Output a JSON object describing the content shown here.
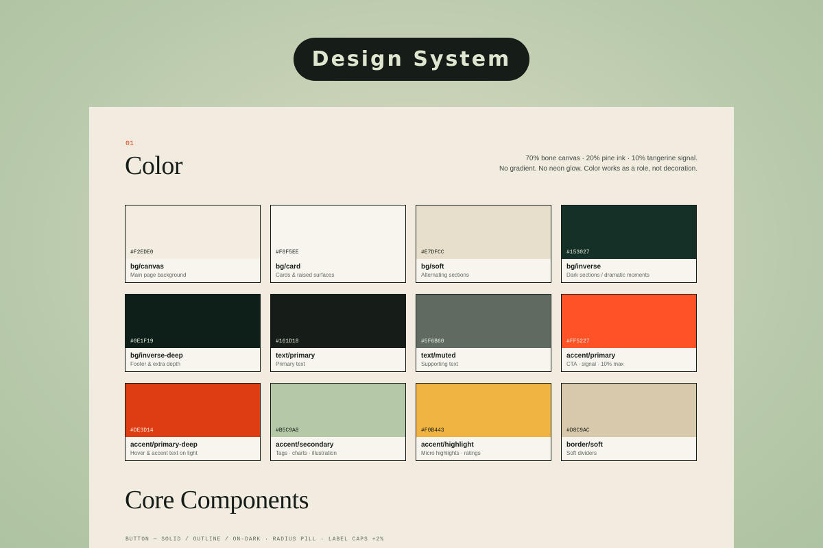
{
  "header": {
    "title": "Design System"
  },
  "color_section": {
    "number": "01",
    "title": "Color",
    "description_line1": "70% bone canvas · 20% pine ink · 10% tangerine signal.",
    "description_line2": "No gradient. No neon glow. Color works as a role, not decoration."
  },
  "swatches": [
    {
      "hex": "#F2EDE0",
      "name": "bg/canvas",
      "note": "Main page background",
      "color": "#F2EDE0",
      "text_color": "#161D18"
    },
    {
      "hex": "#F8F5EE",
      "name": "bg/card",
      "note": "Cards & raised surfaces",
      "color": "#F8F5EE",
      "text_color": "#161D18"
    },
    {
      "hex": "#E7DFCC",
      "name": "bg/soft",
      "note": "Alternating sections",
      "color": "#E7DFCC",
      "text_color": "#161D18"
    },
    {
      "hex": "#153027",
      "name": "bg/inverse",
      "note": "Dark sections / dramatic moments",
      "color": "#153027",
      "text_color": "#E8EDE0"
    },
    {
      "hex": "#0E1F19",
      "name": "bg/inverse-deep",
      "note": "Footer & extra depth",
      "color": "#0E1F19",
      "text_color": "#E8EDE0"
    },
    {
      "hex": "#161D18",
      "name": "text/primary",
      "note": "Primary text",
      "color": "#161D18",
      "text_color": "#E8EDE0"
    },
    {
      "hex": "#5F6B60",
      "name": "text/muted",
      "note": "Supporting text",
      "color": "#5F6B60",
      "text_color": "#E8EDE0"
    },
    {
      "hex": "#FF5227",
      "name": "accent/primary",
      "note": "CTA · signal · 10% max",
      "color": "#FF5227",
      "text_color": "#FBE9E0"
    },
    {
      "hex": "#DE3D14",
      "name": "accent/primary-deep",
      "note": "Hover & accent text on light",
      "color": "#DE3D14",
      "text_color": "#FBE9E0"
    },
    {
      "hex": "#B5C9A8",
      "name": "accent/secondary",
      "note": "Tags · charts · illustration",
      "color": "#B5C9A8",
      "text_color": "#161D18"
    },
    {
      "hex": "#F0B443",
      "name": "accent/highlight",
      "note": "Micro highlights · ratings",
      "color": "#F0B443",
      "text_color": "#161D18"
    },
    {
      "hex": "#D8C9AC",
      "name": "border/soft",
      "note": "Soft dividers",
      "color": "#D8C9AC",
      "text_color": "#161D18"
    }
  ],
  "core_section": {
    "title": "Core Components",
    "subtitle": "BUTTON — SOLID / OUTLINE / ON-DARK · RADIUS PILL · LABEL CAPS +2%"
  }
}
